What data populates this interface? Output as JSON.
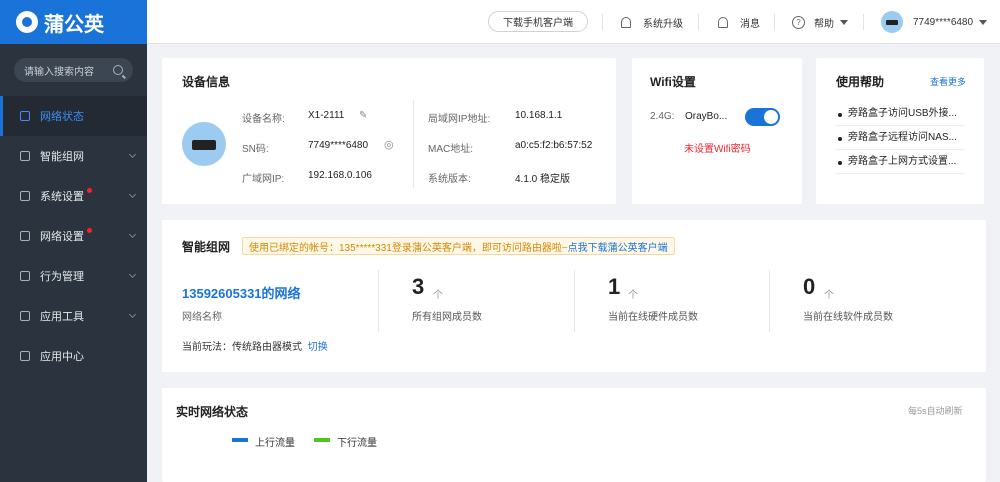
{
  "brand": {
    "name": "蒲公英"
  },
  "sidebar": {
    "search_placeholder": "请输入搜索内容",
    "items": [
      {
        "label": "网络状态",
        "active": true
      },
      {
        "label": "智能组网"
      },
      {
        "label": "系统设置",
        "dot": true
      },
      {
        "label": "网络设置",
        "dot": true
      },
      {
        "label": "行为管理"
      },
      {
        "label": "应用工具"
      },
      {
        "label": "应用中心"
      }
    ]
  },
  "topbar": {
    "download_label": "下载手机客户端",
    "upgrade_label": "系统升级",
    "messages_label": "消息",
    "help_label": "帮助",
    "account": "7749****6480"
  },
  "device": {
    "title": "设备信息",
    "name_label": "设备名称:",
    "name": "X1-2111",
    "sn_label": "SN码:",
    "sn": "7749****6480",
    "wan_label": "广域网IP:",
    "wan": "192.168.0.106",
    "lan_label": "局域网IP地址:",
    "lan": "10.168.1.1",
    "mac_label": "MAC地址:",
    "mac": "a0:c5:f2:b6:57:52",
    "version_label": "系统版本:",
    "version": "4.1.0 稳定版"
  },
  "wifi": {
    "title": "Wifi设置",
    "band": "2.4G:",
    "ssid": "OrayBo...",
    "enabled": true,
    "warning": "未设置Wifi密码"
  },
  "help": {
    "title": "使用帮助",
    "more": "查看更多",
    "items": [
      "旁路盒子访问USB外接...",
      "旁路盒子远程访问NAS...",
      "旁路盒子上网方式设置..."
    ]
  },
  "network": {
    "title": "智能组网",
    "notice": "使用已绑定的帐号：135*****331登录蒲公英客户端，即可访问路由器啦~",
    "notice_link": "点我下载蒲公英客户端",
    "net_name": "13592605331的网络",
    "net_name_label": "网络名称",
    "mode_label": "当前玩法：传统路由器模式",
    "mode_switch": "切换",
    "stats": [
      {
        "value": "3",
        "unit": "个",
        "label": "所有组网成员数"
      },
      {
        "value": "1",
        "unit": "个",
        "label": "当前在线硬件成员数"
      },
      {
        "value": "0",
        "unit": "个",
        "label": "当前在线软件成员数"
      }
    ]
  },
  "realtime": {
    "title": "实时网络状态",
    "refresh": "每5s自动刷新",
    "legend": [
      {
        "name": "上行流量",
        "color": "#1a73d9"
      },
      {
        "name": "下行流量",
        "color": "#52c41a"
      }
    ]
  }
}
